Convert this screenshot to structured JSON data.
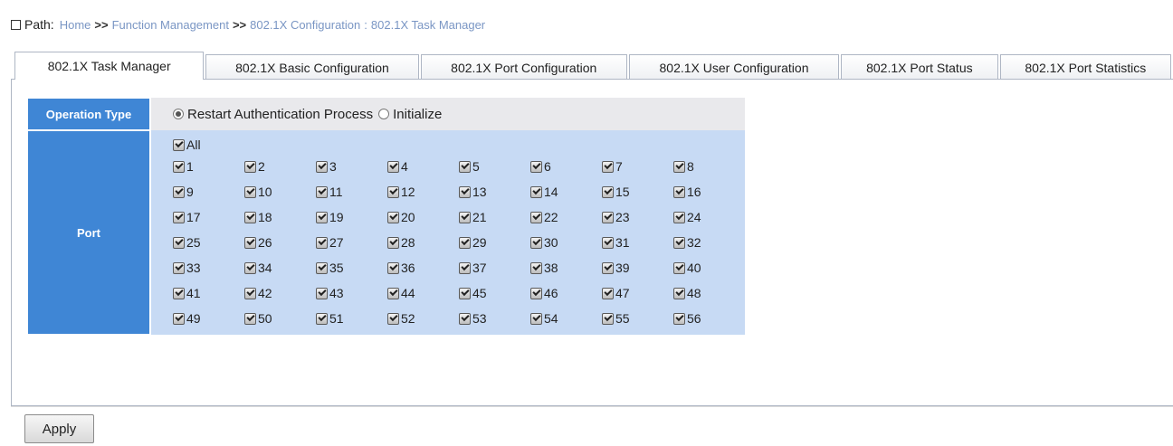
{
  "breadcrumb": {
    "label": "Path:",
    "items": [
      "Home",
      "Function Management",
      "802.1X Configuration",
      "802.1X Task Manager"
    ],
    "separator": ">>",
    "last_separator": ":"
  },
  "tabs": [
    {
      "label": "802.1X Task Manager",
      "active": true
    },
    {
      "label": "802.1X Basic Configuration",
      "active": false
    },
    {
      "label": "802.1X Port Configuration",
      "active": false
    },
    {
      "label": "802.1X User Configuration",
      "active": false
    },
    {
      "label": "802.1X Port Status",
      "active": false
    },
    {
      "label": "802.1X Port Statistics",
      "active": false
    }
  ],
  "form": {
    "operation_type_label": "Operation Type",
    "operation_options": [
      {
        "label": "Restart Authentication Process",
        "selected": true
      },
      {
        "label": "Initialize",
        "selected": false
      }
    ],
    "port_label": "Port",
    "all_label": "All",
    "all_checked": true,
    "ports": [
      "1",
      "2",
      "3",
      "4",
      "5",
      "6",
      "7",
      "8",
      "9",
      "10",
      "11",
      "12",
      "13",
      "14",
      "15",
      "16",
      "17",
      "18",
      "19",
      "20",
      "21",
      "22",
      "23",
      "24",
      "25",
      "26",
      "27",
      "28",
      "29",
      "30",
      "31",
      "32",
      "33",
      "34",
      "35",
      "36",
      "37",
      "38",
      "39",
      "40",
      "41",
      "42",
      "43",
      "44",
      "45",
      "46",
      "47",
      "48",
      "49",
      "50",
      "51",
      "52",
      "53",
      "54",
      "55",
      "56"
    ],
    "ports_checked": true
  },
  "apply_label": "Apply",
  "colors": {
    "label_bg": "#3f86d5",
    "port_area_bg": "#c7daf4",
    "op_area_bg": "#e9e9ec",
    "crumb_link": "#7a96c4"
  }
}
